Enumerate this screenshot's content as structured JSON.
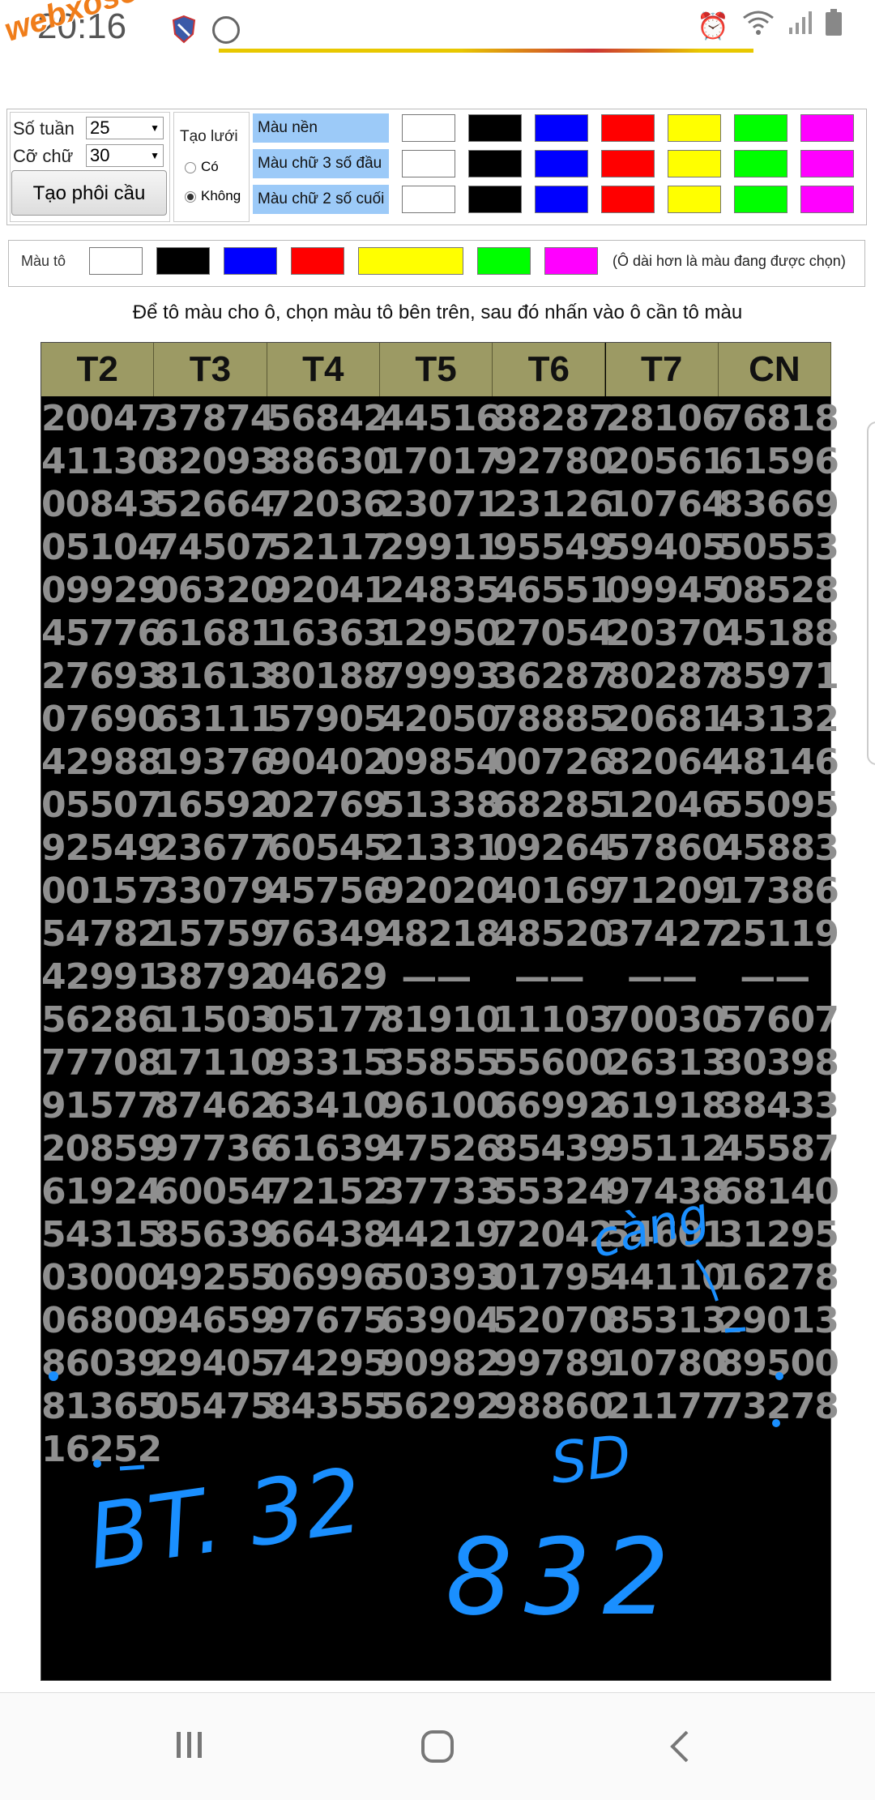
{
  "status": {
    "time": "20:16"
  },
  "watermark": "webxoso.net",
  "controls": {
    "so_tuan_label": "Số tuần",
    "so_tuan_value": "25",
    "co_chu_label": "Cỡ chữ",
    "co_chu_value": "30",
    "tao_phoi_cau": "Tạo phôi cầu",
    "tao_luoi_label": "Tạo lưới",
    "option_co": "Có",
    "option_khong": "Không",
    "rows": [
      {
        "label": "Màu nền"
      },
      {
        "label": "Màu chữ 3 số đầu"
      },
      {
        "label": "Màu chữ 2 số cuối"
      }
    ],
    "palette": [
      "#ffffff",
      "#000000",
      "#0000ff",
      "#ff0000",
      "#ffff00",
      "#00ff00",
      "#ff00ff"
    ],
    "mau_to_label": "Màu tô",
    "mau_to_note": "(Ô dài hơn là màu đang được chọn)",
    "mau_to_selected": "#ffff00"
  },
  "hint": "Để tô màu cho ô, chọn màu tô bên trên, sau đó nhấn vào ô cần tô màu",
  "table": {
    "headers": [
      "T2",
      "T3",
      "T4",
      "T5",
      "T6",
      "T7",
      "CN"
    ],
    "rows": [
      [
        "20047",
        "37874",
        "56842",
        "44516",
        "88287",
        "28106",
        "76818"
      ],
      [
        "41130",
        "82093",
        "88630",
        "17017",
        "92780",
        "20561",
        "61596"
      ],
      [
        "00843",
        "52664",
        "72036",
        "23071",
        "23126",
        "10764",
        "83669"
      ],
      [
        "05104",
        "74507",
        "52117",
        "29911",
        "95549",
        "59405",
        "50553"
      ],
      [
        "09929",
        "06320",
        "92041",
        "24835",
        "46551",
        "09945",
        "08528"
      ],
      [
        "45776",
        "61681",
        "16363",
        "12950",
        "27054",
        "20370",
        "45188"
      ],
      [
        "27693",
        "81613",
        "80188",
        "79993",
        "36287",
        "80287",
        "85971"
      ],
      [
        "07690",
        "63111",
        "57905",
        "42050",
        "78885",
        "20681",
        "43132"
      ],
      [
        "42988",
        "19376",
        "90402",
        "09854",
        "00726",
        "82064",
        "48146"
      ],
      [
        "05507",
        "16592",
        "02769",
        "51338",
        "68285",
        "12046",
        "55095"
      ],
      [
        "92549",
        "23677",
        "60545",
        "21331",
        "09264",
        "57860",
        "45883"
      ],
      [
        "00157",
        "33079",
        "45756",
        "92020",
        "40169",
        "71209",
        "17386"
      ],
      [
        "54782",
        "15759",
        "76349",
        "48218",
        "48520",
        "37427",
        "25119"
      ],
      [
        "42991",
        "38792",
        "04629",
        "——",
        "——",
        "——",
        "——"
      ],
      [
        "56286",
        "11503",
        "05177",
        "81910",
        "11103",
        "70030",
        "57607"
      ],
      [
        "77708",
        "17110",
        "93315",
        "35855",
        "55600",
        "26313",
        "30398"
      ],
      [
        "91577",
        "87462",
        "63410",
        "96100",
        "66992",
        "61918",
        "38433"
      ],
      [
        "20859",
        "97736",
        "61639",
        "47526",
        "85439",
        "95112",
        "45587"
      ],
      [
        "61924",
        "60054",
        "72152",
        "37733",
        "55324",
        "97438",
        "68140"
      ],
      [
        "54315",
        "85639",
        "66438",
        "44219",
        "72042",
        "54601",
        "31295"
      ],
      [
        "03000",
        "49255",
        "06996",
        "50393",
        "01795",
        "44110",
        "16278"
      ],
      [
        "06800",
        "94659",
        "97675",
        "63904",
        "52070",
        "85313",
        "29013"
      ],
      [
        "86039",
        "29405",
        "74295",
        "90982",
        "99789",
        "10780",
        "89500"
      ],
      [
        "81365",
        "05475",
        "84355",
        "56292",
        "98860",
        "21177",
        "73278"
      ],
      [
        "16252",
        "",
        "",
        "",
        "",
        "",
        ""
      ]
    ]
  },
  "handwriting": {
    "cang": "càng",
    "bt": "BT. 32",
    "sd": "SD",
    "num": "832"
  }
}
